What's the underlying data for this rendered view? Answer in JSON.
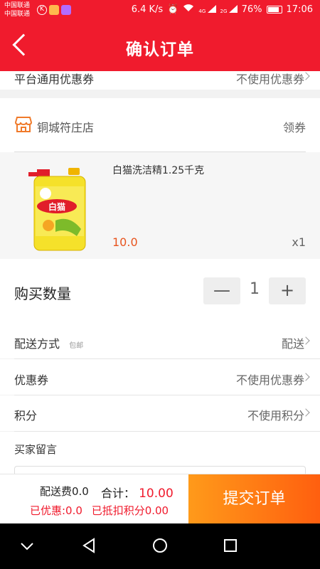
{
  "status_bar": {
    "carrier_1": "中国联通",
    "carrier_2": "中国联通",
    "speed": "6.4 K/s",
    "signal_1": "4G",
    "signal_2": "2G",
    "battery": "76%",
    "time": "17:06"
  },
  "navbar": {
    "title": "确认订单"
  },
  "platform_coupon": {
    "label": "平台通用优惠券",
    "value": "不使用优惠券"
  },
  "store": {
    "name": "铜城符庄店",
    "coupon_link": "领券"
  },
  "product": {
    "name": "白猫洗洁精1.25千克",
    "price": "10.0",
    "quantity": "x1",
    "image_label": "白猫"
  },
  "purchase_quantity": {
    "label": "购买数量",
    "minus": "—",
    "value": "1",
    "plus": "+"
  },
  "delivery": {
    "label": "配送方式",
    "tag": "包邮",
    "value": "配送"
  },
  "coupon": {
    "label": "优惠券",
    "value": "不使用优惠券"
  },
  "points": {
    "label": "积分",
    "value": "不使用积分"
  },
  "buyer_message": {
    "label": "买家留言"
  },
  "footer": {
    "shipping_fee": "配送费0.0",
    "total_label": "合计：",
    "total_value": "10.00",
    "discount": "已优惠:0.0",
    "points_deducted": "已抵扣积分0.00",
    "submit_label": "提交订单"
  },
  "colors": {
    "brand_red": "#f01b2d",
    "price_orange": "#e8541e",
    "submit_gradient_start": "#ff9a1a",
    "submit_gradient_end": "#ff5f0f"
  }
}
